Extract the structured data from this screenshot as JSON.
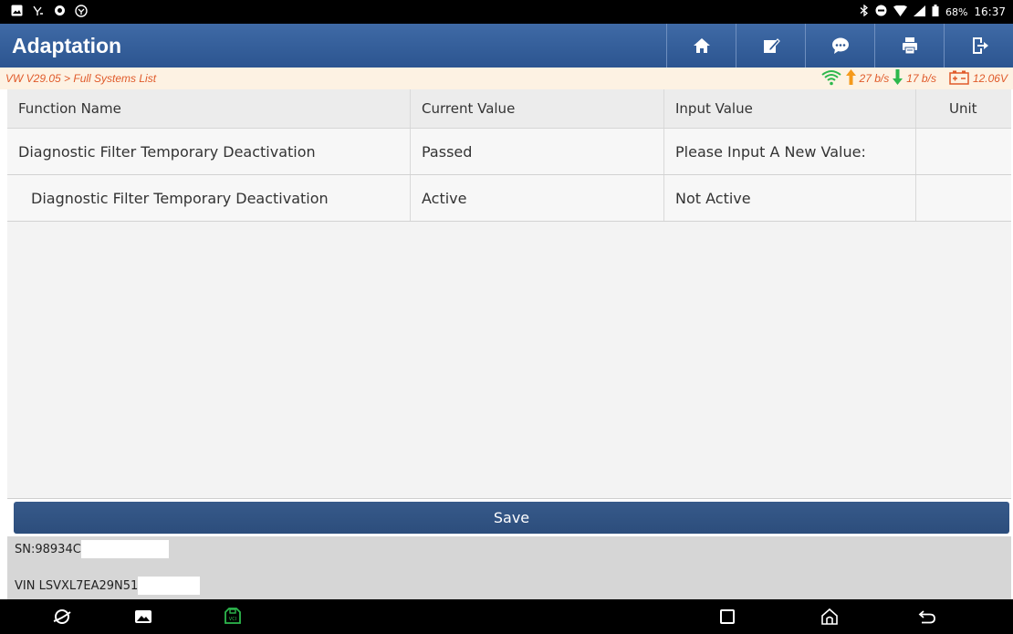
{
  "status_bar": {
    "battery": "68%",
    "time": "16:37"
  },
  "header": {
    "title": "Adaptation",
    "icons": [
      "home-icon",
      "edit-icon",
      "chat-icon",
      "print-icon",
      "exit-icon"
    ]
  },
  "breadcrumb": {
    "path": "VW V29.05 > Full Systems List",
    "upload_rate": "27 b/s",
    "download_rate": "17 b/s",
    "voltage": "12.06V"
  },
  "table": {
    "headers": [
      "Function Name",
      "Current Value",
      "Input Value",
      "Unit"
    ],
    "rows": [
      {
        "function": "Diagnostic Filter Temporary Deactivation",
        "current": "Passed",
        "input": "Please Input A New Value:",
        "unit": ""
      },
      {
        "function": "Diagnostic Filter Temporary Deactivation",
        "current": "Active",
        "input": "Not Active",
        "unit": ""
      }
    ]
  },
  "actions": {
    "save_label": "Save"
  },
  "info": {
    "sn": "SN:98934C",
    "vin": "VIN LSVXL7EA29N51"
  },
  "colors": {
    "title_bar": "#2c5590",
    "accent_orange": "#e05a2a",
    "wifi_green": "#2db84d",
    "save_button": "#2c4d7c"
  }
}
